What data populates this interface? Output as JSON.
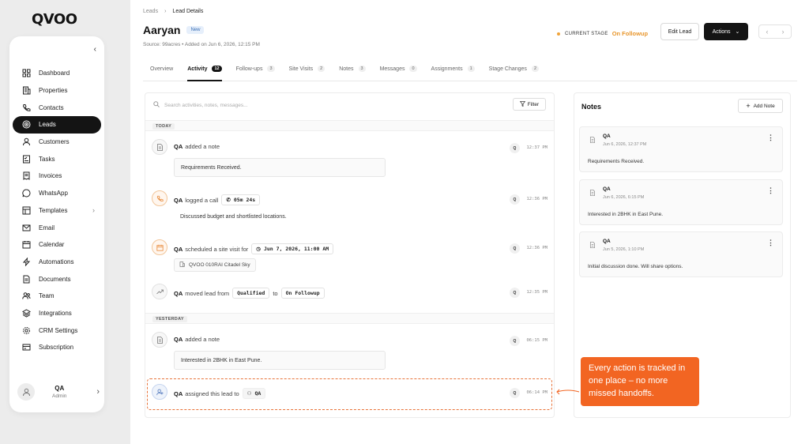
{
  "brand": {
    "logo": "QVOO"
  },
  "sidebar": {
    "items": [
      {
        "label": "Dashboard",
        "icon": "grid-icon"
      },
      {
        "label": "Properties",
        "icon": "building-icon"
      },
      {
        "label": "Contacts",
        "icon": "phone-icon"
      },
      {
        "label": "Leads",
        "icon": "target-icon",
        "active": true
      },
      {
        "label": "Customers",
        "icon": "user-icon"
      },
      {
        "label": "Tasks",
        "icon": "checklist-icon"
      },
      {
        "label": "Invoices",
        "icon": "invoice-icon"
      },
      {
        "label": "WhatsApp",
        "icon": "whatsapp-icon"
      },
      {
        "label": "Templates",
        "icon": "template-icon",
        "has_submenu": true
      },
      {
        "label": "Email",
        "icon": "mail-icon"
      },
      {
        "label": "Calendar",
        "icon": "calendar-icon"
      },
      {
        "label": "Automations",
        "icon": "bolt-icon"
      },
      {
        "label": "Documents",
        "icon": "document-icon"
      },
      {
        "label": "Team",
        "icon": "team-icon"
      },
      {
        "label": "Integrations",
        "icon": "layers-icon"
      },
      {
        "label": "CRM Settings",
        "icon": "gear-icon"
      },
      {
        "label": "Subscription",
        "icon": "card-icon"
      }
    ],
    "profile": {
      "name": "QA",
      "role": "Admin"
    }
  },
  "header": {
    "breadcrumb": [
      "Leads",
      "Lead Details"
    ],
    "breadcrumb_sep": "›",
    "lead_name": "Aaryan",
    "lead_badge": "New",
    "source_line": "Source: 99acres  •  Added on Jun 6, 2026, 12:15 PM",
    "stage_label": "CURRENT STAGE",
    "stage_value": "On Followup",
    "edit_label": "Edit Lead",
    "actions_label": "Actions"
  },
  "tabs": [
    {
      "label": "Overview",
      "count": null
    },
    {
      "label": "Activity",
      "count": "12",
      "active": true
    },
    {
      "label": "Follow-ups",
      "count": "3"
    },
    {
      "label": "Site Visits",
      "count": "2"
    },
    {
      "label": "Notes",
      "count": "3"
    },
    {
      "label": "Messages",
      "count": "0"
    },
    {
      "label": "Assignments",
      "count": "1"
    },
    {
      "label": "Stage Changes",
      "count": "2"
    }
  ],
  "activity": {
    "search_placeholder": "Search activities, notes, messages...",
    "filter_label": "Filter",
    "today_label": "TODAY",
    "yesterday_label": "YESTERDAY",
    "entries": [
      {
        "actor": "QA",
        "action": "added a note",
        "body": "Requirements Received.",
        "time": "12:37 PM",
        "badge": "Q"
      },
      {
        "actor": "QA",
        "action": "logged a call",
        "chip": "05m 24s",
        "body": "Discussed budget and shortlisted locations.",
        "time": "12:36 PM",
        "badge": "Q"
      },
      {
        "actor": "QA",
        "action": "scheduled a site visit for",
        "chip": "Jun 7, 2026, 11:00 AM",
        "sub": "QVOO 010RAI Citadel Sky",
        "time": "12:36 PM",
        "badge": "Q"
      },
      {
        "actor": "QA",
        "action": "moved lead from",
        "from": "Qualified",
        "to_word": "to",
        "to": "On Followup",
        "time": "12:35 PM",
        "badge": "Q"
      },
      {
        "actor": "QA",
        "action": "added a note",
        "body": "Interested in 2BHK in East Pune.",
        "time": "06:15 PM",
        "badge": "Q"
      },
      {
        "actor": "QA",
        "action": "assigned this lead to",
        "chip": "QA",
        "time": "06:14 PM",
        "badge": "Q"
      }
    ]
  },
  "notes": {
    "title": "Notes",
    "add_label": "Add Note",
    "items": [
      {
        "by": "QA",
        "date": "Jun 6, 2026, 12:37 PM",
        "body": "Requirements Received."
      },
      {
        "by": "QA",
        "date": "Jun 6, 2026, 6:15 PM",
        "body": "Interested in 2BHK in East Pune."
      },
      {
        "by": "QA",
        "date": "Jun 5, 2026, 1:10 PM",
        "body": "Initial discussion done. Will share options."
      }
    ]
  },
  "callout": {
    "text": "Every action is tracked in one place – no more missed handoffs."
  },
  "colors": {
    "accent": "#f26522",
    "stage": "#e8962c",
    "dark": "#141414"
  }
}
